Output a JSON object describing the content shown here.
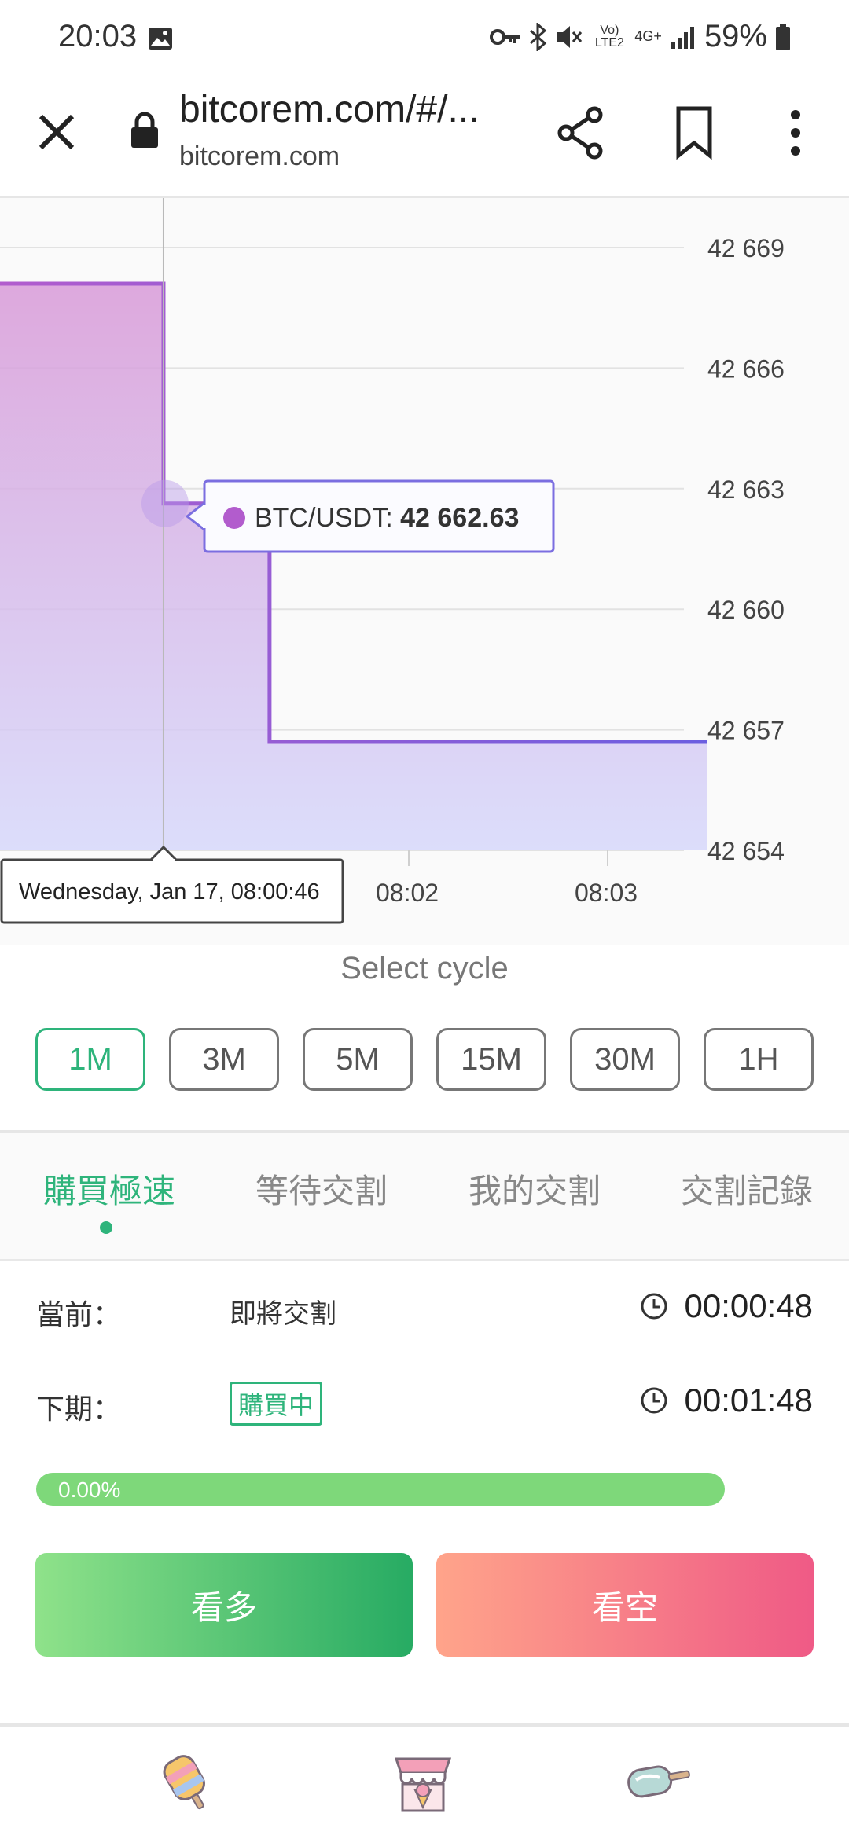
{
  "status_bar": {
    "time": "20:03",
    "battery": "59%",
    "network_label_1": "Vo) LTE2",
    "network_label_2": "4G+"
  },
  "browser": {
    "page_title": "bitcorem.com/#/...",
    "domain": "bitcorem.com"
  },
  "chart_data": {
    "type": "line",
    "series": [
      {
        "name": "BTC/USDT",
        "x": [
          "08:00:44",
          "08:00:46",
          "08:01:18",
          "08:03:30"
        ],
        "values": [
          42668.1,
          42662.63,
          42656.7,
          42656.7
        ]
      }
    ],
    "y_ticks": [
      "42 669",
      "42 666",
      "42 663",
      "42 660",
      "42 657",
      "42 654"
    ],
    "y_tick_values": [
      42669,
      42666,
      42663,
      42660,
      42657,
      42654
    ],
    "x_ticks": [
      "08:02",
      "08:03"
    ],
    "ylim": [
      42654,
      42669
    ],
    "grid": true,
    "tooltip": {
      "series": "BTC/USDT:",
      "value": "42 662.63",
      "date": "Wednesday, Jan 17, 08:00:46"
    },
    "colors": {
      "line_start": "#b25ccd",
      "line_end": "#6b5ee0"
    }
  },
  "cycle": {
    "label": "Select cycle",
    "options": [
      "1M",
      "3M",
      "5M",
      "15M",
      "30M",
      "1H"
    ],
    "selected": "1M"
  },
  "tabs": [
    "購買極速",
    "等待交割",
    "我的交割",
    "交割記錄"
  ],
  "current": {
    "label": "當前：",
    "status": "即將交割",
    "timer": "00:00:48"
  },
  "next": {
    "label": "下期：",
    "status": "購買中",
    "timer": "00:01:48"
  },
  "progress": {
    "text": "0.00%",
    "value": 0
  },
  "actions": {
    "long": "看多",
    "short": "看空"
  },
  "bottom_nav": [
    "popsicle-icon",
    "shop-icon",
    "ice-cream-bar-icon"
  ]
}
